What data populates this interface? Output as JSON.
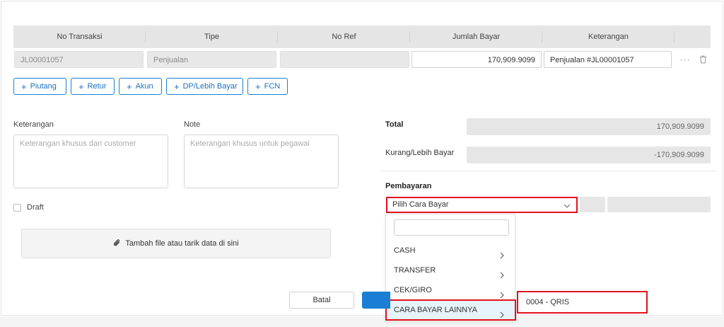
{
  "table": {
    "headers": [
      "No Transaksi",
      "Tipe",
      "No Ref",
      "Jumlah Bayar",
      "Keterangan"
    ],
    "row": {
      "no_transaksi": "JL00001057",
      "tipe": "Penjualan",
      "no_ref": "",
      "jumlah_bayar": "170,909.9099",
      "keterangan": "Penjualan #JL00001057"
    }
  },
  "add_buttons": [
    "Piutang",
    "Retur",
    "Akun",
    "DP/Lebih Bayar",
    "FCN"
  ],
  "form": {
    "keterangan_label": "Keterangan",
    "keterangan_placeholder": "Keterangan khusus dari customer",
    "note_label": "Note",
    "note_placeholder": "Keterangan khusus untuk pegawai",
    "draft_label": "Draft",
    "upload_label": "Tambah file atau tarik data di sini"
  },
  "summary": {
    "total_label": "Total",
    "total_value": "170,909.9099",
    "kurang_label": "Kurang/Lebih Bayar",
    "kurang_value": "-170,909.9099",
    "pembayaran_label": "Pembayaran",
    "select_placeholder": "Pilih Cara Bayar"
  },
  "dropdown": {
    "items": [
      "CASH",
      "TRANSFER",
      "CEK/GIRO",
      "CARA BAYAR LAINNYA"
    ],
    "active_index": 3,
    "submenu_option": "0004 - QRIS"
  },
  "actions": {
    "cancel_label": "Batal"
  },
  "colors": {
    "accent": "#1a7fd4",
    "highlight_border": "#e2121b",
    "active_item_bg": "#e6f3f8"
  },
  "icons": [
    "plus-icon",
    "ellipsis-icon",
    "trash-icon",
    "paperclip-icon",
    "chevron-down-icon",
    "chevron-right-icon"
  ]
}
